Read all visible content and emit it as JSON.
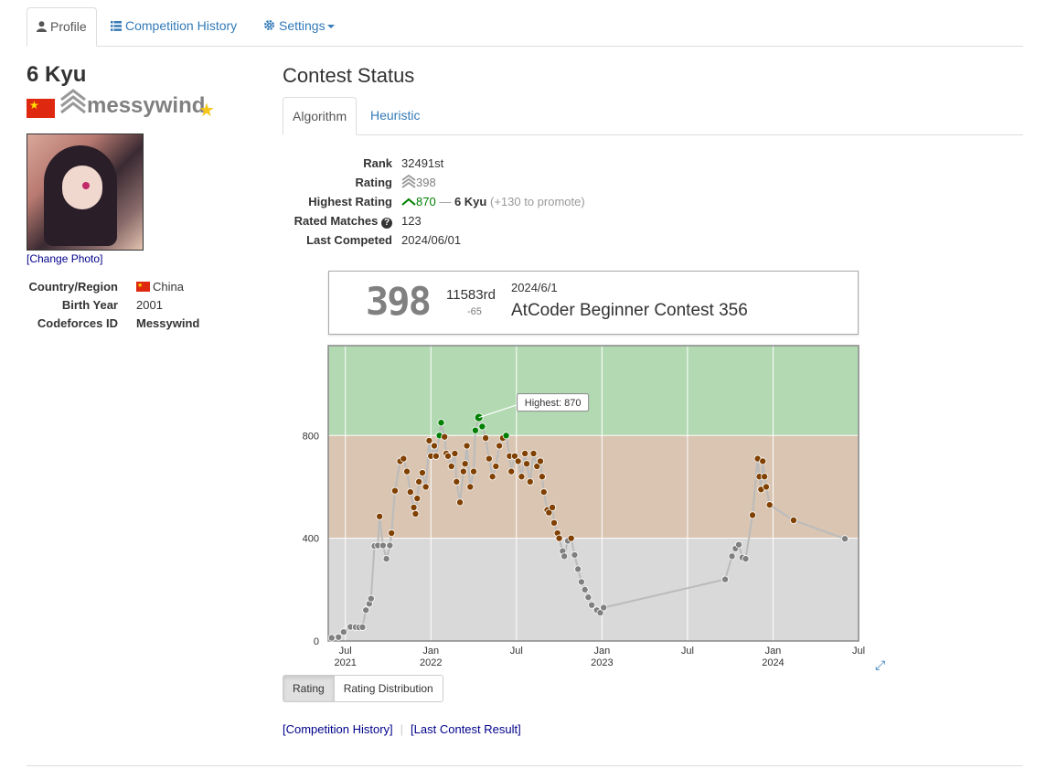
{
  "nav": {
    "profile": "Profile",
    "history": "Competition History",
    "settings": "Settings"
  },
  "user": {
    "kyu": "6 Kyu",
    "name": "messywind",
    "change_photo": "[Change Photo]",
    "info": [
      {
        "key": "Country/Region",
        "value": "China"
      },
      {
        "key": "Birth Year",
        "value": "2001"
      },
      {
        "key": "Codeforces ID",
        "value": "Messywind"
      }
    ]
  },
  "contest_status": {
    "title": "Contest Status",
    "tabs": [
      "Algorithm",
      "Heuristic"
    ],
    "rank_label": "Rank",
    "rank": "32491st",
    "rating_label": "Rating",
    "rating": "398",
    "highest_label": "Highest Rating",
    "highest": "870",
    "highest_sep": "—",
    "highest_kyu": "6 Kyu",
    "highest_promote": "(+130 to promote)",
    "matches_label": "Rated Matches",
    "matches": "123",
    "last_label": "Last Competed",
    "last": "2024/06/01"
  },
  "last_result": {
    "rating": "398",
    "rank": "11583rd",
    "diff": "-65",
    "date": "2024/6/1",
    "contest": "AtCoder Beginner Contest 356"
  },
  "chart_data": {
    "type": "line",
    "ylim": [
      0,
      1150
    ],
    "yticks": [
      0,
      400,
      800
    ],
    "xticks": [
      {
        "month": "Jul",
        "year": "2021",
        "t": 2021.5
      },
      {
        "month": "Jan",
        "year": "2022",
        "t": 2022.0
      },
      {
        "month": "Jul",
        "year": "",
        "t": 2022.5
      },
      {
        "month": "Jan",
        "year": "2023",
        "t": 2023.0
      },
      {
        "month": "Jul",
        "year": "",
        "t": 2023.5
      },
      {
        "month": "Jan",
        "year": "2024",
        "t": 2024.0
      },
      {
        "month": "Jul",
        "year": "",
        "t": 2024.5
      }
    ],
    "xlim": [
      2021.4,
      2024.5
    ],
    "bands": [
      {
        "from": 0,
        "to": 400,
        "color": "#d9d9d9"
      },
      {
        "from": 400,
        "to": 800,
        "color": "#d9c5b2"
      },
      {
        "from": 800,
        "to": 1150,
        "color": "#b2d9b2"
      }
    ],
    "annotation": "Highest: 870",
    "points": [
      [
        2021.42,
        12
      ],
      [
        2021.46,
        15
      ],
      [
        2021.49,
        35
      ],
      [
        2021.53,
        55
      ],
      [
        2021.56,
        54
      ],
      [
        2021.58,
        53
      ],
      [
        2021.6,
        54
      ],
      [
        2021.62,
        120
      ],
      [
        2021.64,
        145
      ],
      [
        2021.65,
        165
      ],
      [
        2021.67,
        370
      ],
      [
        2021.69,
        372
      ],
      [
        2021.7,
        485
      ],
      [
        2021.72,
        372
      ],
      [
        2021.74,
        320
      ],
      [
        2021.76,
        372
      ],
      [
        2021.77,
        420
      ],
      [
        2021.79,
        585
      ],
      [
        2021.82,
        700
      ],
      [
        2021.84,
        710
      ],
      [
        2021.86,
        660
      ],
      [
        2021.88,
        580
      ],
      [
        2021.9,
        520
      ],
      [
        2021.91,
        495
      ],
      [
        2021.92,
        555
      ],
      [
        2021.93,
        620
      ],
      [
        2021.95,
        655
      ],
      [
        2021.97,
        600
      ],
      [
        2021.99,
        780
      ],
      [
        2022.0,
        720
      ],
      [
        2022.02,
        760
      ],
      [
        2022.03,
        720
      ],
      [
        2022.05,
        800
      ],
      [
        2022.06,
        850
      ],
      [
        2022.08,
        795
      ],
      [
        2022.09,
        730
      ],
      [
        2022.1,
        720
      ],
      [
        2022.12,
        680
      ],
      [
        2022.14,
        730
      ],
      [
        2022.15,
        620
      ],
      [
        2022.17,
        540
      ],
      [
        2022.19,
        660
      ],
      [
        2022.2,
        690
      ],
      [
        2022.21,
        760
      ],
      [
        2022.23,
        600
      ],
      [
        2022.25,
        660
      ],
      [
        2022.26,
        820
      ],
      [
        2022.28,
        870
      ],
      [
        2022.3,
        835
      ],
      [
        2022.32,
        790
      ],
      [
        2022.34,
        710
      ],
      [
        2022.36,
        640
      ],
      [
        2022.38,
        680
      ],
      [
        2022.4,
        760
      ],
      [
        2022.42,
        790
      ],
      [
        2022.44,
        800
      ],
      [
        2022.46,
        720
      ],
      [
        2022.47,
        660
      ],
      [
        2022.49,
        720
      ],
      [
        2022.51,
        700
      ],
      [
        2022.53,
        640
      ],
      [
        2022.55,
        730
      ],
      [
        2022.56,
        690
      ],
      [
        2022.58,
        620
      ],
      [
        2022.6,
        730
      ],
      [
        2022.62,
        680
      ],
      [
        2022.64,
        700
      ],
      [
        2022.65,
        640
      ],
      [
        2022.66,
        580
      ],
      [
        2022.68,
        510
      ],
      [
        2022.69,
        500
      ],
      [
        2022.71,
        520
      ],
      [
        2022.72,
        460
      ],
      [
        2022.74,
        420
      ],
      [
        2022.75,
        400
      ],
      [
        2022.77,
        350
      ],
      [
        2022.78,
        330
      ],
      [
        2022.8,
        390
      ],
      [
        2022.82,
        400
      ],
      [
        2022.84,
        335
      ],
      [
        2022.86,
        280
      ],
      [
        2022.88,
        230
      ],
      [
        2022.9,
        200
      ],
      [
        2022.92,
        170
      ],
      [
        2022.94,
        140
      ],
      [
        2022.97,
        120
      ],
      [
        2022.99,
        110
      ],
      [
        2023.01,
        130
      ],
      [
        2023.72,
        240
      ],
      [
        2023.76,
        330
      ],
      [
        2023.78,
        360
      ],
      [
        2023.8,
        375
      ],
      [
        2023.82,
        325
      ],
      [
        2023.84,
        320
      ],
      [
        2023.88,
        490
      ],
      [
        2023.91,
        710
      ],
      [
        2023.92,
        640
      ],
      [
        2023.93,
        590
      ],
      [
        2023.94,
        700
      ],
      [
        2023.95,
        640
      ],
      [
        2023.96,
        600
      ],
      [
        2023.98,
        530
      ],
      [
        2024.12,
        470
      ],
      [
        2024.42,
        398
      ]
    ]
  },
  "buttons": {
    "rating": "Rating",
    "distribution": "Rating Distribution"
  },
  "links": {
    "history": "[Competition History]",
    "last_result": "[Last Contest Result]"
  }
}
